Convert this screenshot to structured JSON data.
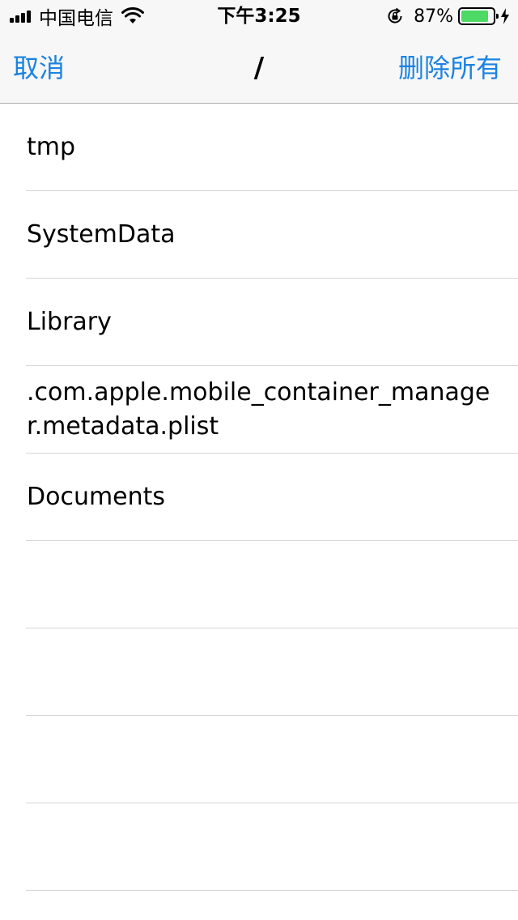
{
  "status_bar": {
    "carrier": "中国电信",
    "time": "下午3:25",
    "battery_percent": "87%",
    "battery_level": 0.87,
    "icons": [
      "signal-icon",
      "wifi-icon",
      "rotation-lock-icon",
      "battery-icon",
      "charging-bolt-icon"
    ]
  },
  "nav": {
    "cancel_label": "取消",
    "title": "/",
    "delete_all_label": "删除所有"
  },
  "files": [
    {
      "name": "tmp"
    },
    {
      "name": "SystemData"
    },
    {
      "name": "Library"
    },
    {
      "name": ".com.apple.mobile_container_manager.metadata.plist"
    },
    {
      "name": "Documents"
    },
    {
      "name": ""
    },
    {
      "name": ""
    },
    {
      "name": ""
    },
    {
      "name": ""
    }
  ],
  "colors": {
    "accent": "#1a82e2",
    "bar_background": "#f7f7f7",
    "separator": "#d6d6d9",
    "battery_fill": "#4cd964"
  }
}
